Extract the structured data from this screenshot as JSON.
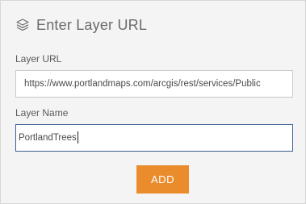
{
  "header": {
    "icon": "layers-icon",
    "title": "Enter Layer URL"
  },
  "fields": {
    "url": {
      "label": "Layer URL",
      "value": "https://www.portlandmaps.com/arcgis/rest/services/Public"
    },
    "name": {
      "label": "Layer Name",
      "value": "PortlandTrees"
    }
  },
  "actions": {
    "add_label": "ADD"
  },
  "colors": {
    "accent": "#ea8c2c",
    "focus_border": "#3b5f8f"
  }
}
